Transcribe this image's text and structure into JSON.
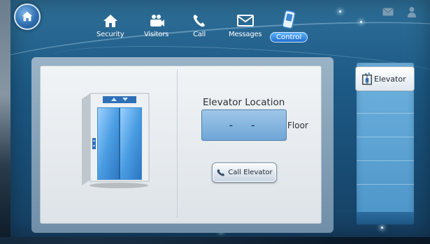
{
  "nav": {
    "items": [
      {
        "id": "security",
        "label": "Security"
      },
      {
        "id": "visitors",
        "label": "Visitors"
      },
      {
        "id": "call",
        "label": "Call"
      },
      {
        "id": "messages",
        "label": "Messages"
      },
      {
        "id": "control",
        "label": "Control",
        "active": true
      }
    ]
  },
  "main": {
    "location_title": "Elevator Location",
    "location_value": "- -",
    "floor_label": "Floor",
    "call_button_label": "Call Elevator"
  },
  "side": {
    "tab_label": "Elevator"
  },
  "colors": {
    "accent": "#1f6fcf",
    "app_bg": "#1d5a86"
  }
}
